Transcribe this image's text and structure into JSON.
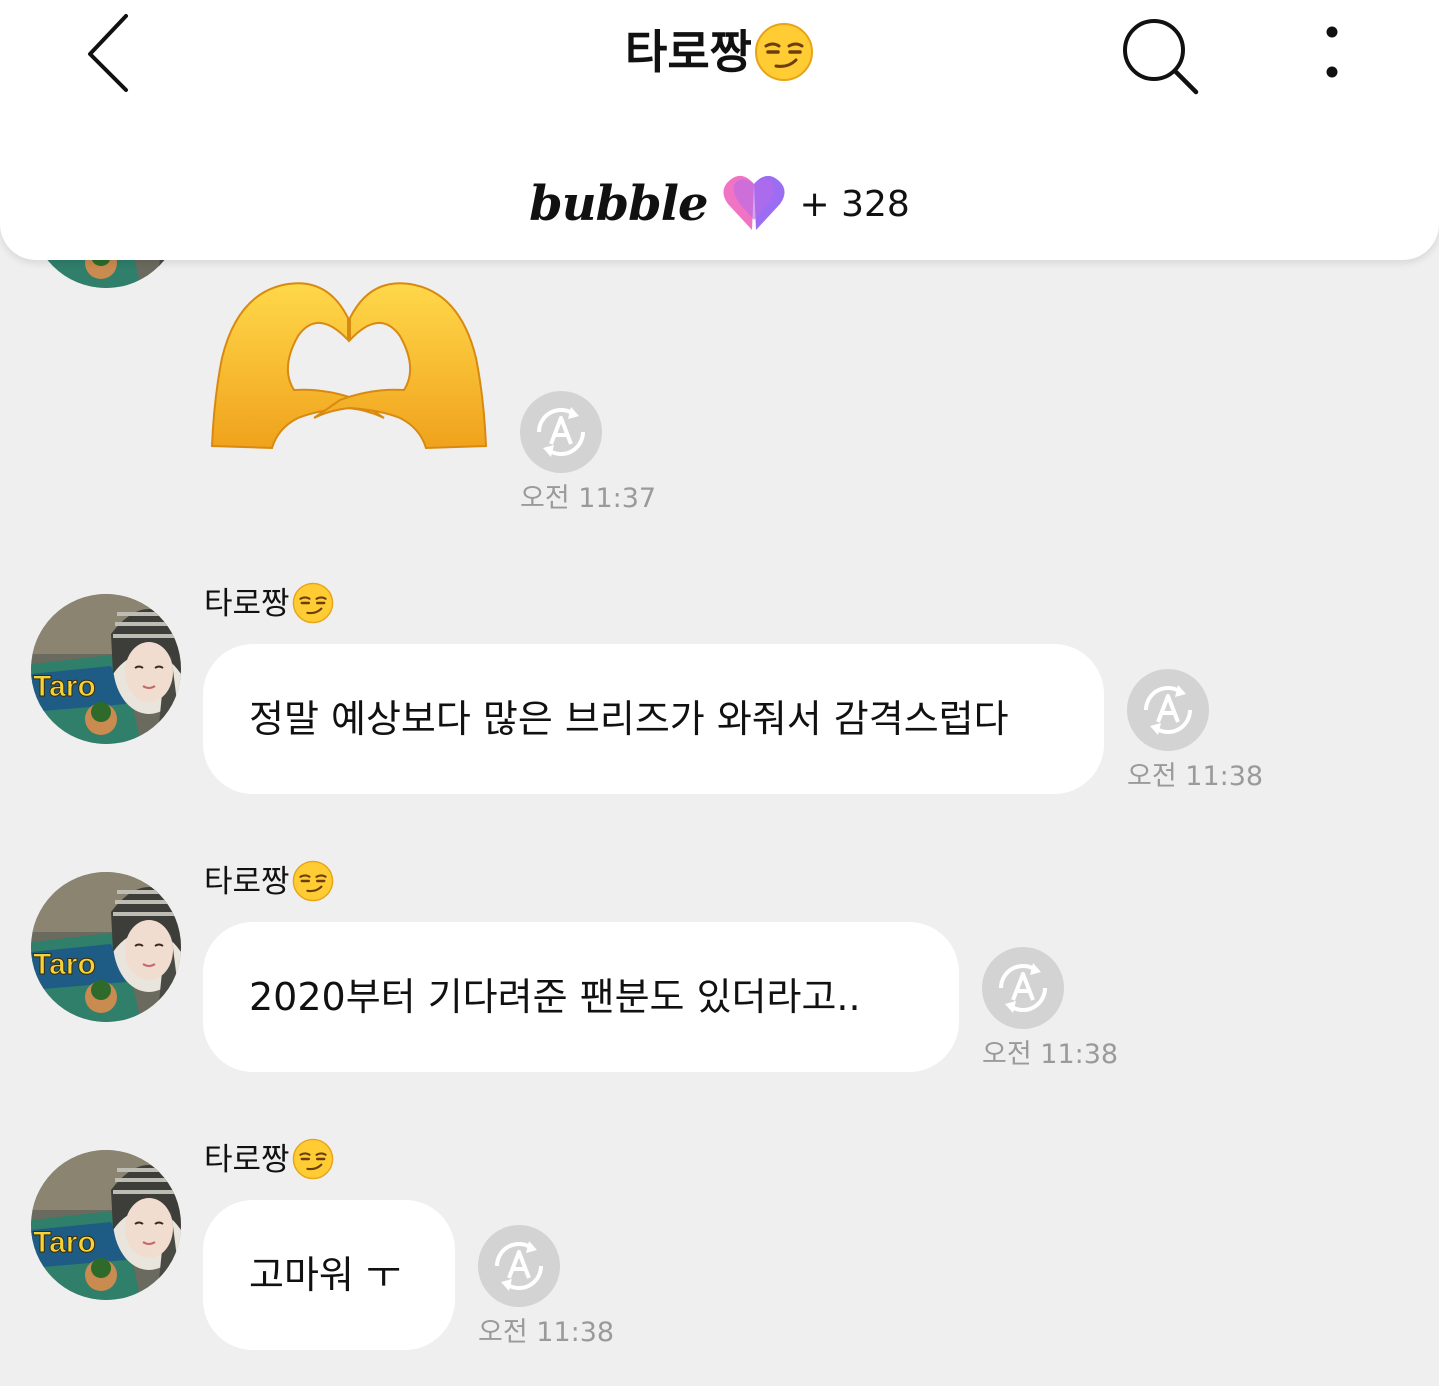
{
  "header": {
    "title": "타로짱",
    "title_emoji": "smirking-face-emoji",
    "bubble_label": "bubble",
    "bubble_count": "+ 328"
  },
  "colors": {
    "background": "#efefef",
    "bubble": "#ffffff",
    "timestamp": "#9a9a9a",
    "heart_pink": "#f173c4",
    "heart_purple": "#9b6df2"
  },
  "messages": [
    {
      "type": "emoji",
      "emoji": "heart-hands-emoji",
      "time": "오전 11:37"
    },
    {
      "type": "text",
      "sender": "타로짱",
      "text": "정말 예상보다 많은 브리즈가 와줘서 감격스럽다",
      "time": "오전 11:38"
    },
    {
      "type": "text",
      "sender": "타로짱",
      "text": "2020부터 기다려준 팬분도 있더라고..",
      "time": "오전 11:38"
    },
    {
      "type": "text",
      "sender": "타로짱",
      "text": "고마워 ㅜ",
      "time": "오전 11:38"
    }
  ]
}
